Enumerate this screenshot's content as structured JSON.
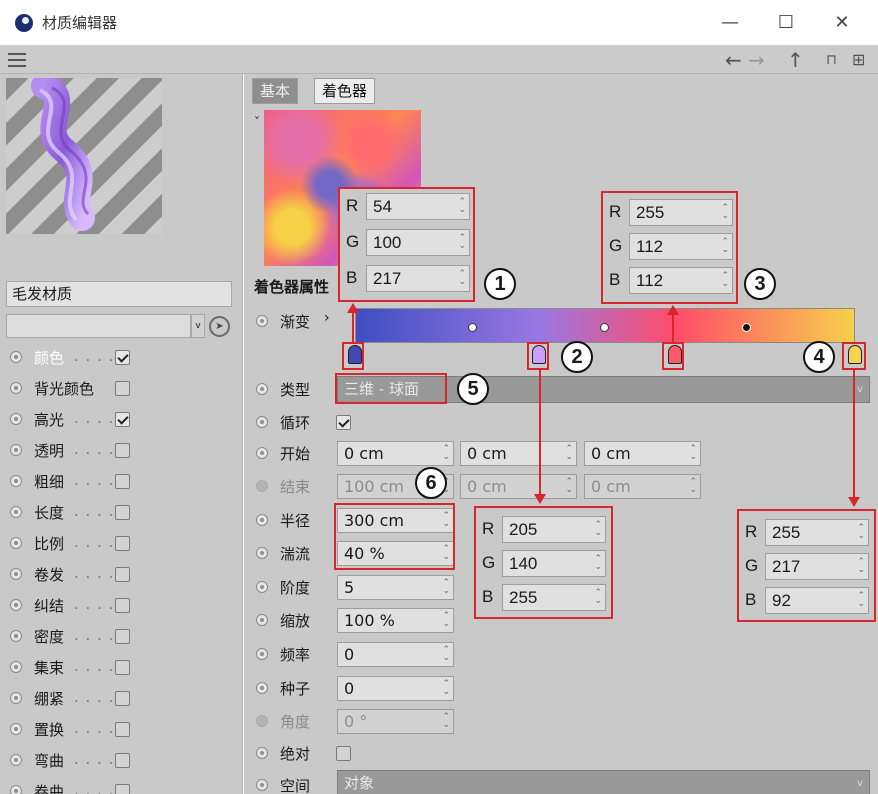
{
  "window": {
    "title": "材质编辑器",
    "minimize": "—",
    "maximize": "☐",
    "close": "✕"
  },
  "toolbar": {
    "back": "←",
    "forward": "→",
    "up": "↑",
    "lock": "🔓",
    "new": "⊞"
  },
  "material": {
    "name": "毛发材质"
  },
  "channels": [
    {
      "label": "颜色",
      "checked": true
    },
    {
      "label": "背光颜色",
      "checked": false
    },
    {
      "label": "高光",
      "checked": true
    },
    {
      "label": "透明",
      "checked": false
    },
    {
      "label": "粗细",
      "checked": false
    },
    {
      "label": "长度",
      "checked": false
    },
    {
      "label": "比例",
      "checked": false
    },
    {
      "label": "卷发",
      "checked": false
    },
    {
      "label": "纠结",
      "checked": false
    },
    {
      "label": "密度",
      "checked": false
    },
    {
      "label": "集束",
      "checked": false
    },
    {
      "label": "绷紧",
      "checked": false
    },
    {
      "label": "置换",
      "checked": false
    },
    {
      "label": "弯曲",
      "checked": false
    },
    {
      "label": "卷曲",
      "checked": false
    }
  ],
  "tabs": {
    "basic": "基本",
    "shader": "着色器"
  },
  "shader": {
    "section": "着色器属性",
    "gradient_label": "渐变",
    "type_label": "类型",
    "type_value": "三维 - 球面",
    "cycle_label": "循环",
    "cycle_checked": true,
    "start_label": "开始",
    "start": [
      "0 cm",
      "0 cm",
      "0 cm"
    ],
    "end_label": "结束",
    "end": [
      "100 cm",
      "0 cm",
      "0 cm"
    ],
    "radius_label": "半径",
    "radius": "300 cm",
    "turbulence_label": "湍流",
    "turbulence": "40 %",
    "octaves_label": "阶度",
    "octaves": "5",
    "scale_label": "缩放",
    "scale": "100 %",
    "frequency_label": "频率",
    "frequency": "0",
    "seed_label": "种子",
    "seed": "0",
    "angle_label": "角度",
    "angle": "0 °",
    "absolute_label": "绝对",
    "space_label": "空间",
    "space": "对象"
  },
  "gradient_stops": [
    {
      "position": 0.0,
      "color": "#3637ba"
    },
    {
      "position": 0.37,
      "color": "#cd8cff"
    },
    {
      "position": 0.64,
      "color": "#ff7070"
    },
    {
      "position": 1.0,
      "color": "#ffd95c"
    }
  ],
  "annotations": {
    "stop1": {
      "number": "1",
      "R": "54",
      "G": "100",
      "B": "217"
    },
    "stop2": {
      "number": "2",
      "R": "205",
      "G": "140",
      "B": "255"
    },
    "stop3": {
      "number": "3",
      "R": "255",
      "G": "112",
      "B": "112"
    },
    "stop4": {
      "number": "4",
      "R": "255",
      "G": "217",
      "B": "92"
    },
    "type_callout": "5",
    "radius_callout": "6",
    "letters": {
      "r": "R",
      "g": "G",
      "b": "B"
    }
  },
  "colors": {
    "highlight": "#d8262e",
    "panel": "#c9c9c9"
  }
}
